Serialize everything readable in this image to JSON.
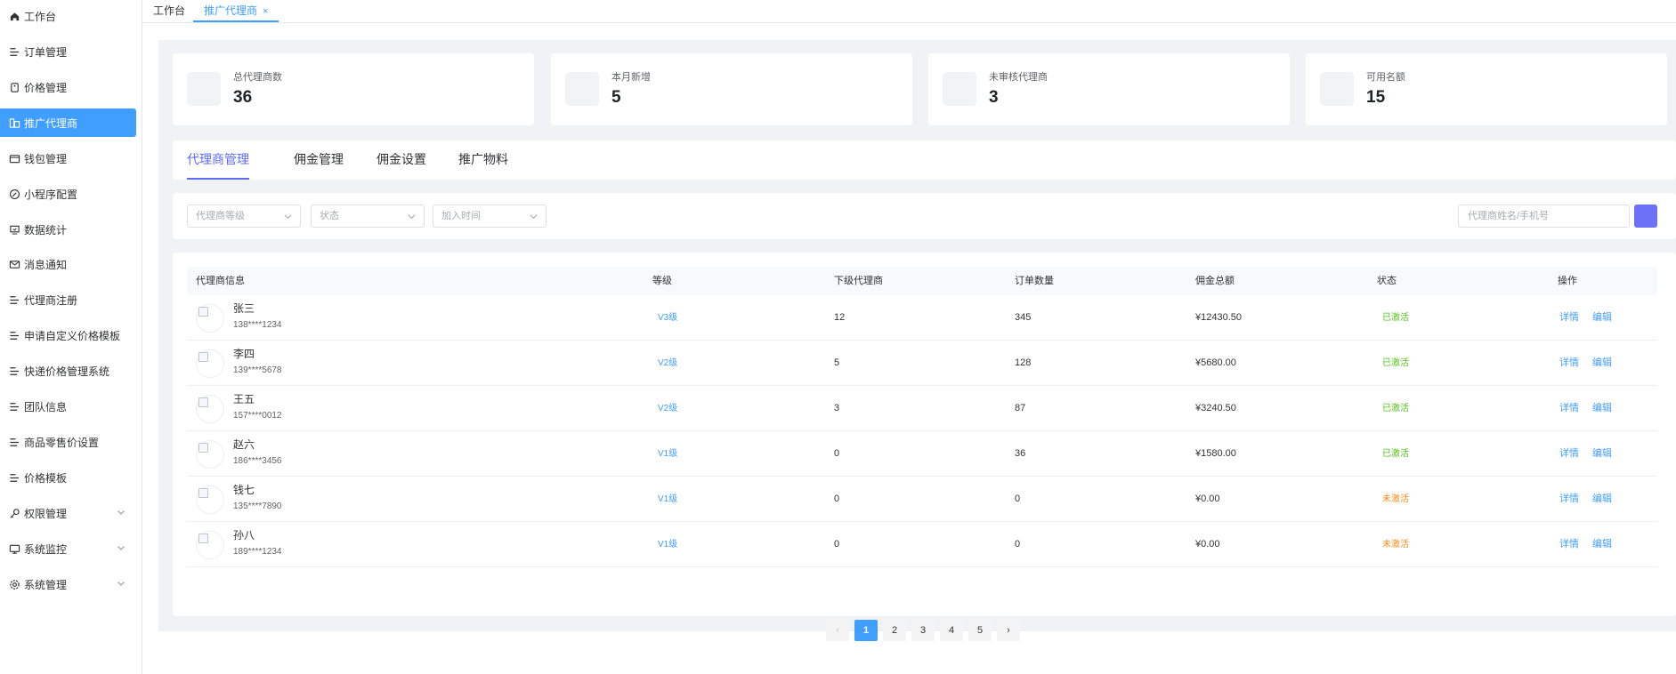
{
  "sidebar": {
    "items": [
      {
        "label": "工作台",
        "icon": "home-icon"
      },
      {
        "label": "订单管理",
        "icon": "list-icon"
      },
      {
        "label": "价格管理",
        "icon": "price-tag-icon"
      },
      {
        "label": "推广代理商",
        "icon": "agent-icon",
        "active": true
      },
      {
        "label": "钱包管理",
        "icon": "wallet-icon"
      },
      {
        "label": "小程序配置",
        "icon": "compass-icon"
      },
      {
        "label": "数据统计",
        "icon": "chart-icon"
      },
      {
        "label": "消息通知",
        "icon": "mail-icon"
      },
      {
        "label": "代理商注册",
        "icon": "list-icon"
      },
      {
        "label": "申请自定义价格模板",
        "icon": "list-icon"
      },
      {
        "label": "快递价格管理系统",
        "icon": "list-icon"
      },
      {
        "label": "团队信息",
        "icon": "list-icon"
      },
      {
        "label": "商品零售价设置",
        "icon": "list-icon"
      },
      {
        "label": "价格模板",
        "icon": "list-icon"
      },
      {
        "label": "权限管理",
        "icon": "key-icon",
        "expandable": true
      },
      {
        "label": "系统监控",
        "icon": "monitor-icon",
        "expandable": true
      },
      {
        "label": "系统管理",
        "icon": "gear-icon",
        "expandable": true
      }
    ]
  },
  "tabs": [
    {
      "label": "工作台"
    },
    {
      "label": "推广代理商",
      "active": true,
      "close": "×"
    }
  ],
  "stats": [
    {
      "label": "总代理商数",
      "value": "36"
    },
    {
      "label": "本月新增",
      "value": "5"
    },
    {
      "label": "未审核代理商",
      "value": "3"
    },
    {
      "label": "可用名额",
      "value": "15"
    }
  ],
  "sub_tabs": [
    "代理商管理",
    "佣金管理",
    "佣金设置",
    "推广物料"
  ],
  "filters": {
    "level_placeholder": "代理商等级",
    "status_placeholder": "状态",
    "time_placeholder": "加入时间",
    "search_placeholder": "代理商姓名/手机号"
  },
  "table": {
    "columns": [
      "代理商信息",
      "等级",
      "下级代理商",
      "订单数量",
      "佣金总额",
      "状态",
      "操作"
    ],
    "rows": [
      {
        "name": "张三",
        "phone": "138****1234",
        "level": "V3级",
        "sub": "12",
        "orders": "345",
        "commission": "¥12430.50",
        "status": "已激活",
        "status_type": "on"
      },
      {
        "name": "李四",
        "phone": "139****5678",
        "level": "V2级",
        "sub": "5",
        "orders": "128",
        "commission": "¥5680.00",
        "status": "已激活",
        "status_type": "on"
      },
      {
        "name": "王五",
        "phone": "157****0012",
        "level": "V2级",
        "sub": "3",
        "orders": "87",
        "commission": "¥3240.50",
        "status": "已激活",
        "status_type": "on"
      },
      {
        "name": "赵六",
        "phone": "186****3456",
        "level": "V1级",
        "sub": "0",
        "orders": "36",
        "commission": "¥1580.00",
        "status": "已激活",
        "status_type": "on"
      },
      {
        "name": "钱七",
        "phone": "135****7890",
        "level": "V1级",
        "sub": "0",
        "orders": "0",
        "commission": "¥0.00",
        "status": "未激活",
        "status_type": "off"
      },
      {
        "name": "孙八",
        "phone": "189****1234",
        "level": "V1级",
        "sub": "0",
        "orders": "0",
        "commission": "¥0.00",
        "status": "未激活",
        "status_type": "off"
      }
    ],
    "actions": {
      "detail": "详情",
      "edit": "编辑"
    }
  },
  "pagination": {
    "prev": "‹",
    "next": "›",
    "pages": [
      "1",
      "2",
      "3",
      "4",
      "5"
    ],
    "current": "1"
  },
  "colors": {
    "primary": "#409eff",
    "accent": "#5b6cf6",
    "active_status": "#52c41a",
    "inactive_status": "#fa8c16"
  }
}
